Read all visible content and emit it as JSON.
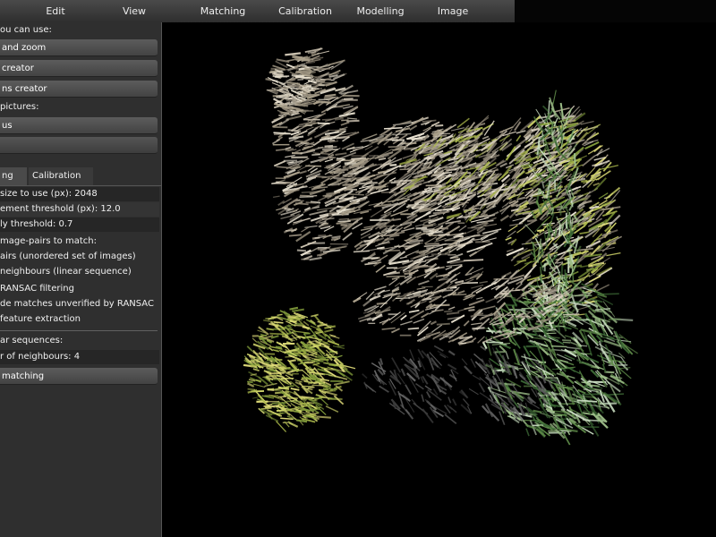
{
  "menubar": {
    "items": [
      {
        "label": "Edit"
      },
      {
        "label": "View"
      },
      {
        "label": "Matching"
      },
      {
        "label": "Calibration"
      },
      {
        "label": "Modelling"
      },
      {
        "label": "Image"
      }
    ]
  },
  "sidebar": {
    "tools_heading": "ou can use:",
    "tool_buttons": [
      {
        "label": "and zoom"
      },
      {
        "label": "creator"
      },
      {
        "label": "ns creator"
      }
    ],
    "pictures_heading": "pictures:",
    "picture_buttons": [
      {
        "label": "us"
      },
      {
        "label": ""
      }
    ],
    "tabs": [
      {
        "label": "ng"
      },
      {
        "label": "Calibration"
      }
    ],
    "settings": [
      {
        "text": "size to use (px): 2048"
      },
      {
        "text": "ement threshold (px): 12.0"
      },
      {
        "text": "ly threshold: 0.7"
      },
      {
        "text": "mage-pairs to match:"
      },
      {
        "text": "airs (unordered set of images)"
      },
      {
        "text": "neighbours (linear sequence)"
      },
      {
        "text": "RANSAC filtering"
      },
      {
        "text": "de matches unverified by RANSAC"
      },
      {
        "text": "feature extraction"
      }
    ],
    "linear_heading": "ar sequences:",
    "neighbours_text": "r of neighbours: 4",
    "match_button": "matching"
  },
  "viewport": {
    "colors": {
      "background": "#000000",
      "stone": "#cfc6b4",
      "stone_dark": "#8f8676",
      "foliage_yellow": "#a8b64a",
      "foliage_green": "#5e8a48",
      "tree_pale": "#c8dcc0"
    }
  }
}
